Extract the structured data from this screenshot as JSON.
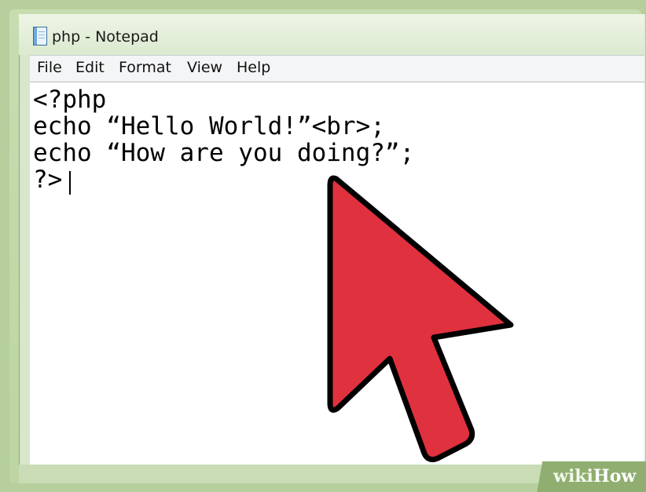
{
  "window": {
    "title": "php - Notepad",
    "icon": "notepad-icon"
  },
  "menu": {
    "items": [
      "File",
      "Edit",
      "Format",
      "View",
      "Help"
    ]
  },
  "editor": {
    "lines": [
      "<?php",
      "echo “Hello World!”<br>;",
      "echo “How are you doing?”;",
      "?>"
    ]
  },
  "overlay": {
    "cursor_icon": "mouse-pointer-arrow-icon",
    "cursor_color": "#e0313f"
  },
  "watermark": {
    "part1": "wiki",
    "part2": "How"
  },
  "colors": {
    "background": "#b6cf9c",
    "editor_bg": "#ffffff",
    "menubar_bg": "#f4f5f7"
  }
}
